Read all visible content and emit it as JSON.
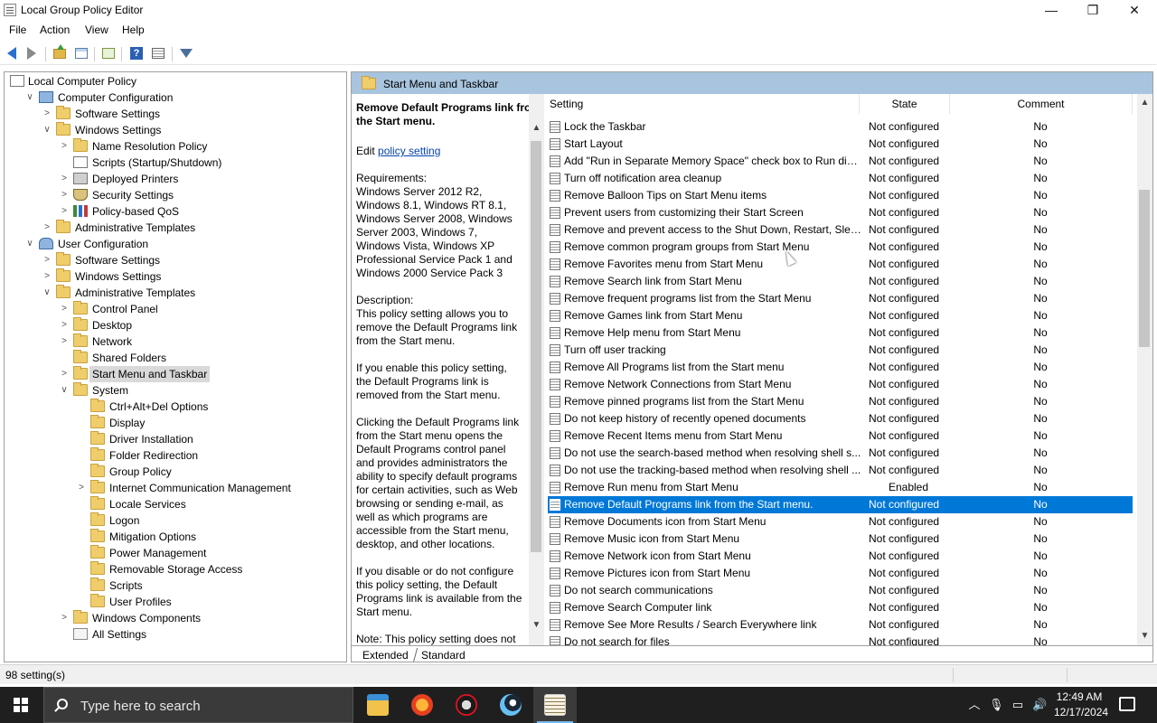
{
  "window": {
    "title": "Local Group Policy Editor",
    "controls": {
      "minimize": "—",
      "maximize": "❐",
      "close": "✕"
    }
  },
  "menu": [
    "File",
    "Action",
    "View",
    "Help"
  ],
  "toolbar": {
    "icons": [
      "back-arrow-icon",
      "forward-arrow-icon",
      "up-folder-icon",
      "show-hide-tree-icon",
      "export-list-icon",
      "help-icon",
      "properties-icon",
      "filter-icon"
    ]
  },
  "tree": {
    "nodes": [
      {
        "label": "Local Computer Policy",
        "icon": "policy"
      },
      {
        "label": "Computer Configuration",
        "icon": "computer",
        "expander": "∨"
      },
      {
        "label": "Software Settings",
        "icon": "folder",
        "expander": ">"
      },
      {
        "label": "Windows Settings",
        "icon": "folder",
        "expander": "∨"
      },
      {
        "label": "Name Resolution Policy",
        "icon": "folder",
        "expander": ">"
      },
      {
        "label": "Scripts (Startup/Shutdown)",
        "icon": "policy"
      },
      {
        "label": "Deployed Printers",
        "icon": "printer",
        "expander": ">"
      },
      {
        "label": "Security Settings",
        "icon": "shield",
        "expander": ">"
      },
      {
        "label": "Policy-based QoS",
        "icon": "chart",
        "expander": ">"
      },
      {
        "label": "Administrative Templates",
        "icon": "folder",
        "expander": ">"
      },
      {
        "label": "User Configuration",
        "icon": "users",
        "expander": "∨"
      },
      {
        "label": "Software Settings",
        "icon": "folder",
        "expander": ">"
      },
      {
        "label": "Windows Settings",
        "icon": "folder",
        "expander": ">"
      },
      {
        "label": "Administrative Templates",
        "icon": "folder",
        "expander": "∨"
      },
      {
        "label": "Control Panel",
        "icon": "folder",
        "expander": ">"
      },
      {
        "label": "Desktop",
        "icon": "folder",
        "expander": ">"
      },
      {
        "label": "Network",
        "icon": "folder",
        "expander": ">"
      },
      {
        "label": "Shared Folders",
        "icon": "folder"
      },
      {
        "label": "Start Menu and Taskbar",
        "icon": "folder",
        "expander": ">",
        "selected": true
      },
      {
        "label": "System",
        "icon": "folder",
        "expander": "∨"
      },
      {
        "label": "Ctrl+Alt+Del Options",
        "icon": "folder"
      },
      {
        "label": "Display",
        "icon": "folder"
      },
      {
        "label": "Driver Installation",
        "icon": "folder"
      },
      {
        "label": "Folder Redirection",
        "icon": "folder"
      },
      {
        "label": "Group Policy",
        "icon": "folder"
      },
      {
        "label": "Internet Communication Management",
        "icon": "folder",
        "expander": ">"
      },
      {
        "label": "Locale Services",
        "icon": "folder"
      },
      {
        "label": "Logon",
        "icon": "folder"
      },
      {
        "label": "Mitigation Options",
        "icon": "folder"
      },
      {
        "label": "Power Management",
        "icon": "folder"
      },
      {
        "label": "Removable Storage Access",
        "icon": "folder"
      },
      {
        "label": "Scripts",
        "icon": "folder"
      },
      {
        "label": "User Profiles",
        "icon": "folder"
      },
      {
        "label": "Windows Components",
        "icon": "folder",
        "expander": ">"
      },
      {
        "label": "All Settings",
        "icon": "allsettings"
      }
    ]
  },
  "right": {
    "header": "Start Menu and Taskbar",
    "description": {
      "title": "Remove Default Programs link from the Start menu.",
      "edit_prefix": "Edit",
      "edit_link": "policy setting",
      "requirements": "Requirements:\nWindows Server 2012 R2, Windows 8.1, Windows RT 8.1, Windows Server 2008, Windows Server 2003, Windows 7, Windows Vista, Windows XP Professional Service Pack 1 and Windows 2000 Service Pack 3",
      "description": "Description:\nThis policy setting allows you to remove the Default Programs link from the Start menu.",
      "p1": "If you enable this policy setting, the Default Programs link is removed from the Start menu.",
      "p2": "Clicking the Default Programs link from the Start menu opens the Default Programs control panel and provides administrators the ability to specify default programs for certain activities, such as Web browsing or sending e-mail, as well as which programs are accessible from the Start menu, desktop, and other locations.",
      "p3": "If you disable or do not configure this policy setting, the Default Programs link is available from the Start menu.",
      "p4": "Note: This policy setting does not"
    },
    "columns": {
      "setting": "Setting",
      "state": "State",
      "comment": "Comment"
    },
    "rows": [
      {
        "setting": "Lock the Taskbar",
        "state": "Not configured",
        "comment": "No"
      },
      {
        "setting": "Start Layout",
        "state": "Not configured",
        "comment": "No"
      },
      {
        "setting": "Add \"Run in Separate Memory Space\" check box to Run dial...",
        "state": "Not configured",
        "comment": "No"
      },
      {
        "setting": "Turn off notification area cleanup",
        "state": "Not configured",
        "comment": "No"
      },
      {
        "setting": "Remove Balloon Tips on Start Menu items",
        "state": "Not configured",
        "comment": "No"
      },
      {
        "setting": "Prevent users from customizing their Start Screen",
        "state": "Not configured",
        "comment": "No"
      },
      {
        "setting": "Remove and prevent access to the Shut Down, Restart, Sleep...",
        "state": "Not configured",
        "comment": "No"
      },
      {
        "setting": "Remove common program groups from Start Menu",
        "state": "Not configured",
        "comment": "No"
      },
      {
        "setting": "Remove Favorites menu from Start Menu",
        "state": "Not configured",
        "comment": "No"
      },
      {
        "setting": "Remove Search link from Start Menu",
        "state": "Not configured",
        "comment": "No"
      },
      {
        "setting": "Remove frequent programs list from the Start Menu",
        "state": "Not configured",
        "comment": "No"
      },
      {
        "setting": "Remove Games link from Start Menu",
        "state": "Not configured",
        "comment": "No"
      },
      {
        "setting": "Remove Help menu from Start Menu",
        "state": "Not configured",
        "comment": "No"
      },
      {
        "setting": "Turn off user tracking",
        "state": "Not configured",
        "comment": "No"
      },
      {
        "setting": "Remove All Programs list from the Start menu",
        "state": "Not configured",
        "comment": "No"
      },
      {
        "setting": "Remove Network Connections from Start Menu",
        "state": "Not configured",
        "comment": "No"
      },
      {
        "setting": "Remove pinned programs list from the Start Menu",
        "state": "Not configured",
        "comment": "No"
      },
      {
        "setting": "Do not keep history of recently opened documents",
        "state": "Not configured",
        "comment": "No"
      },
      {
        "setting": "Remove Recent Items menu from Start Menu",
        "state": "Not configured",
        "comment": "No"
      },
      {
        "setting": "Do not use the search-based method when resolving shell s...",
        "state": "Not configured",
        "comment": "No"
      },
      {
        "setting": "Do not use the tracking-based method when resolving shell ...",
        "state": "Not configured",
        "comment": "No"
      },
      {
        "setting": "Remove Run menu from Start Menu",
        "state": "Enabled",
        "comment": "No"
      },
      {
        "setting": "Remove Default Programs link from the Start menu.",
        "state": "Not configured",
        "comment": "No",
        "selected": true
      },
      {
        "setting": "Remove Documents icon from Start Menu",
        "state": "Not configured",
        "comment": "No"
      },
      {
        "setting": "Remove Music icon from Start Menu",
        "state": "Not configured",
        "comment": "No"
      },
      {
        "setting": "Remove Network icon from Start Menu",
        "state": "Not configured",
        "comment": "No"
      },
      {
        "setting": "Remove Pictures icon from Start Menu",
        "state": "Not configured",
        "comment": "No"
      },
      {
        "setting": "Do not search communications",
        "state": "Not configured",
        "comment": "No"
      },
      {
        "setting": "Remove Search Computer link",
        "state": "Not configured",
        "comment": "No"
      },
      {
        "setting": "Remove See More Results / Search Everywhere link",
        "state": "Not configured",
        "comment": "No"
      },
      {
        "setting": "Do not search for files",
        "state": "Not configured",
        "comment": "No"
      }
    ],
    "tabs": [
      "Extended",
      "Standard"
    ]
  },
  "status": {
    "text": "98 setting(s)"
  },
  "taskbar": {
    "search_placeholder": "Type here to search",
    "apps": [
      "file-explorer",
      "firefox",
      "app-3",
      "steam",
      "group-policy-editor"
    ],
    "clock_time": "12:49 AM",
    "clock_date": "12/17/2024",
    "accent": "#76b9ed"
  },
  "colors": {
    "selection": "#0078d7",
    "header_band": "#a8c4de"
  }
}
